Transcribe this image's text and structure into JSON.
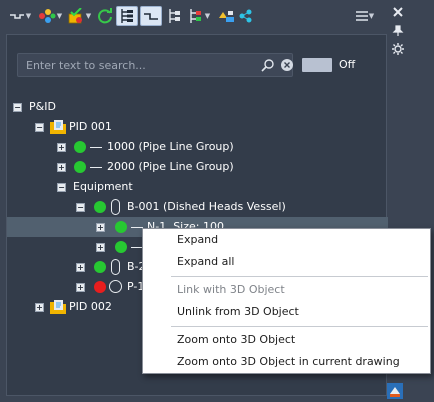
{
  "toolbar": {
    "items": [
      {
        "icon": "pipe-line-icon",
        "has_dropdown": true
      },
      {
        "icon": "color-nodes-icon",
        "has_dropdown": true
      },
      {
        "icon": "validate-icon",
        "has_dropdown": true
      },
      {
        "icon": "refresh-icon",
        "has_dropdown": false
      },
      {
        "icon": "tree-view-icon",
        "active": true
      },
      {
        "icon": "connector-view-icon",
        "active": true
      },
      {
        "icon": "hierarchy-icon"
      },
      {
        "icon": "hierarchy-colored-icon",
        "has_dropdown": true
      },
      {
        "icon": "assign-tags-icon"
      },
      {
        "icon": "network-icon"
      },
      {
        "icon": "menu-icon",
        "has_dropdown": true
      }
    ]
  },
  "side_tools": {
    "icons": [
      "close-icon",
      "pin-icon",
      "settings-icon"
    ]
  },
  "search": {
    "placeholder": "Enter text to search...",
    "value": ""
  },
  "toggle": {
    "label": "Off",
    "on": false
  },
  "tree": {
    "root": {
      "label": "P&ID",
      "expanded": true
    },
    "pid_001": {
      "label": "PID 001",
      "expanded": true
    },
    "line_1000": {
      "label": "1000 (Pipe Line Group)",
      "status": "green"
    },
    "line_2000": {
      "label": "2000 (Pipe Line Group)",
      "status": "green"
    },
    "equipment": {
      "label": "Equipment",
      "expanded": true
    },
    "b001": {
      "label": "B-001 (Dished Heads Vessel)",
      "status": "green"
    },
    "n1": {
      "label": "N-1, Size: 100",
      "status": "green",
      "selected": true
    },
    "n2": {
      "label": "",
      "status": "green"
    },
    "b2": {
      "label": "B-2",
      "status": "green"
    },
    "p1": {
      "label": "P-1",
      "status": "red"
    },
    "pid_002": {
      "label": "PID 002",
      "expanded": false
    }
  },
  "context_menu": {
    "expand": "Expand",
    "expand_all": "Expand all",
    "link_3d": "Link with 3D Object",
    "unlink_3d": "Unlink from 3D Object",
    "zoom_3d": "Zoom onto 3D Object",
    "zoom_3d_current": "Zoom onto 3D Object in current drawing"
  },
  "colors": {
    "background": "#3b4453",
    "panel": "#333c4a",
    "status_ok": "#27c832",
    "status_error": "#e81e1e",
    "selection": "#51606f",
    "menu_background": "#ffffff"
  }
}
